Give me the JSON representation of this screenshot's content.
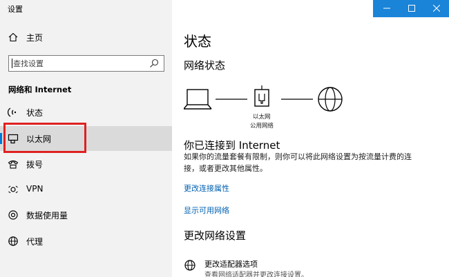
{
  "window": {
    "title": "设置",
    "accent": "#0078d7",
    "titlebar_color": "#1a84d8"
  },
  "sidebar": {
    "home_label": "主页",
    "home_icon": "home-icon",
    "search_placeholder": "查找设置",
    "section_title": "网络和 Internet",
    "items": [
      {
        "label": "状态",
        "icon": "status-icon"
      },
      {
        "label": "以太网",
        "icon": "ethernet-icon",
        "selected": true
      },
      {
        "label": "拨号",
        "icon": "dialup-icon"
      },
      {
        "label": "VPN",
        "icon": "vpn-icon"
      },
      {
        "label": "数据使用量",
        "icon": "data-usage-icon"
      },
      {
        "label": "代理",
        "icon": "proxy-icon"
      }
    ],
    "highlight_color": "#e02020"
  },
  "main": {
    "title": "状态",
    "network_status_heading": "网络状态",
    "diagram": {
      "network_label_line1": "以太网",
      "network_label_line2": "公用网络"
    },
    "connected_title": "你已连接到 Internet",
    "connected_desc": "如果你的流量套餐有限制，则你可以将此网络设置为按流量计费的连接，或者更改其他属性。",
    "link_change_properties": "更改连接属性",
    "link_show_networks": "显示可用网络",
    "change_settings_heading": "更改网络设置",
    "adapter_title": "更改适配器选项",
    "adapter_desc": "查看网络适配器并更改连接设置。",
    "link_color": "#0060b0"
  }
}
